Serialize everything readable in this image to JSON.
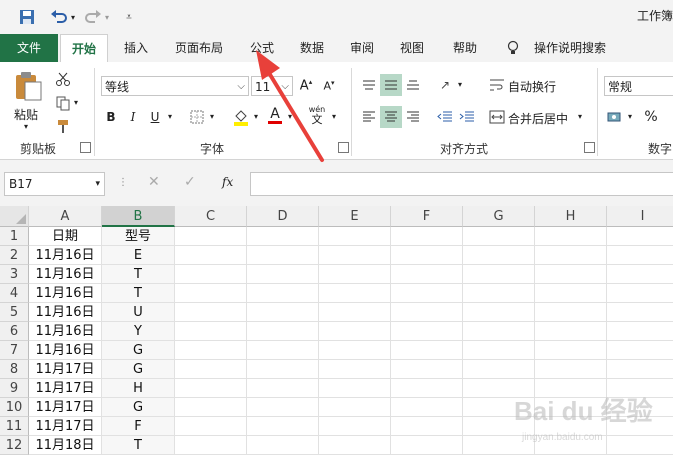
{
  "window": {
    "title": "工作簿"
  },
  "quick_access": {
    "icons": [
      "save-icon",
      "undo-icon",
      "redo-icon",
      "customize-icon"
    ]
  },
  "tabs": [
    {
      "label": "文件"
    },
    {
      "label": "开始"
    },
    {
      "label": "插入"
    },
    {
      "label": "页面布局"
    },
    {
      "label": "公式"
    },
    {
      "label": "数据"
    },
    {
      "label": "审阅"
    },
    {
      "label": "视图"
    },
    {
      "label": "帮助"
    },
    {
      "label": "操作说明搜索"
    }
  ],
  "ribbon": {
    "clipboard": {
      "paste_label": "粘贴",
      "group_label": "剪贴板"
    },
    "font": {
      "font_name": "等线",
      "font_size": "11",
      "bold": "B",
      "italic": "I",
      "underline": "U",
      "font_color_glyph": "A",
      "phonetic_glyph_top": "wén",
      "phonetic_glyph_bottom": "文",
      "group_label": "字体"
    },
    "alignment": {
      "wrap_label": "自动换行",
      "merge_label": "合并后居中",
      "group_label": "对齐方式"
    },
    "number": {
      "format": "常规",
      "percent": "%",
      "group_label": "数字"
    }
  },
  "formula_bar": {
    "name_box": "B17",
    "fx": "fx",
    "formula": ""
  },
  "sheet": {
    "columns": [
      "A",
      "B",
      "C",
      "D",
      "E",
      "F",
      "G",
      "H",
      "I"
    ],
    "selected_column": "B",
    "rows": [
      {
        "n": "1",
        "a": "日期",
        "b": "型号"
      },
      {
        "n": "2",
        "a": "11月16日",
        "b": "E"
      },
      {
        "n": "3",
        "a": "11月16日",
        "b": "T"
      },
      {
        "n": "4",
        "a": "11月16日",
        "b": "T"
      },
      {
        "n": "5",
        "a": "11月16日",
        "b": "U"
      },
      {
        "n": "6",
        "a": "11月16日",
        "b": "Y"
      },
      {
        "n": "7",
        "a": "11月16日",
        "b": "G"
      },
      {
        "n": "8",
        "a": "11月17日",
        "b": "G"
      },
      {
        "n": "9",
        "a": "11月17日",
        "b": "H"
      },
      {
        "n": "10",
        "a": "11月17日",
        "b": "G"
      },
      {
        "n": "11",
        "a": "11月17日",
        "b": "F"
      },
      {
        "n": "12",
        "a": "11月18日",
        "b": "T"
      }
    ]
  },
  "watermark": {
    "text": "Bai du 经验",
    "sub": "jingyan.baidu.com"
  },
  "annotation": {
    "color": "#e8403a"
  }
}
